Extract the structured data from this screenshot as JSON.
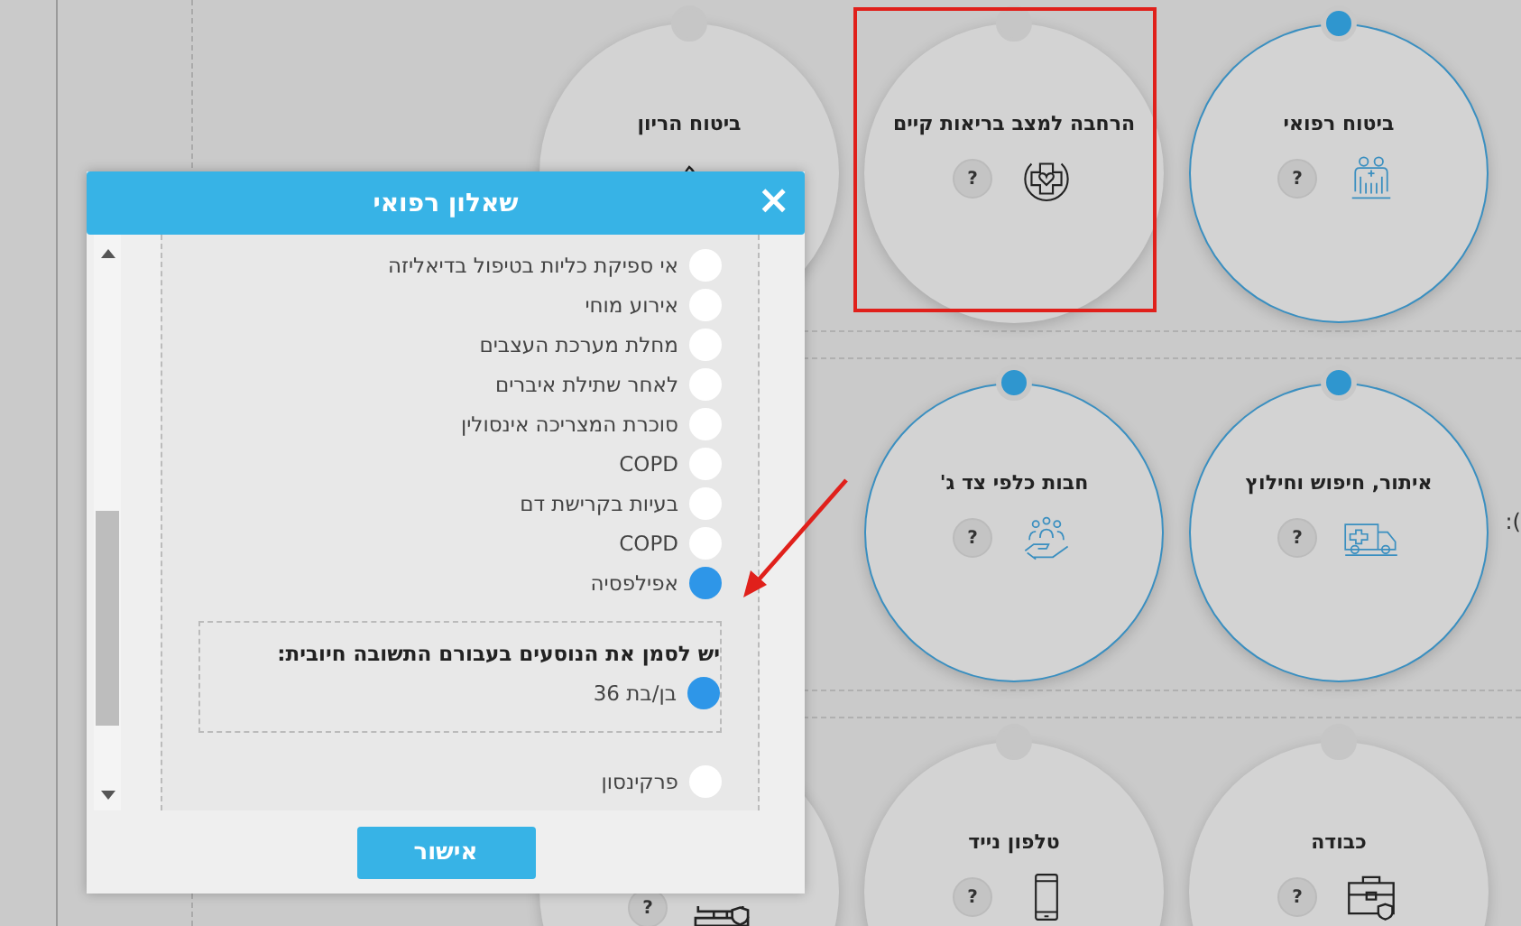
{
  "cards": [
    {
      "title": "ביטוח רפואי",
      "selected": true,
      "help": "?"
    },
    {
      "title": "הרחבה למצב בריאות קיים",
      "selected": false,
      "help": "?"
    },
    {
      "title": "ביטוח הריון",
      "selected": false
    },
    {
      "title": "איתור, חיפוש וחילוץ",
      "selected": true,
      "help": "?"
    },
    {
      "title": "חבות כלפי צד ג'",
      "selected": true,
      "help": "?"
    },
    {
      "title": "כבודה",
      "selected": false,
      "help": "?"
    },
    {
      "title": "טלפון נייד",
      "selected": false,
      "help": "?"
    },
    {
      "help": "?",
      "selected": false
    }
  ],
  "edge_text": ":(",
  "dialog": {
    "title": "שאלון רפואי",
    "close": "×",
    "items": [
      {
        "label": "אי ספיקת כליות בטיפול בדיאליזה",
        "selected": false
      },
      {
        "label": "אירוע מוחי",
        "selected": false
      },
      {
        "label": "מחלת מערכת העצבים",
        "selected": false
      },
      {
        "label": "לאחר שתילת איברים",
        "selected": false
      },
      {
        "label": "סוכרת המצריכה אינסולין",
        "selected": false
      },
      {
        "label": "COPD",
        "selected": false
      },
      {
        "label": "בעיות בקרישת דם",
        "selected": false
      },
      {
        "label": "COPD",
        "selected": false
      },
      {
        "label": "אפילפסיה",
        "selected": true,
        "followup": {
          "prompt": "יש לסמן את הנוסעים בעבורם התשובה חיובית:",
          "travelers": [
            {
              "label": "בן/בת 36",
              "selected": true
            }
          ]
        }
      },
      {
        "label": "פרקינסון",
        "selected": false
      }
    ],
    "confirm": "אישור"
  }
}
